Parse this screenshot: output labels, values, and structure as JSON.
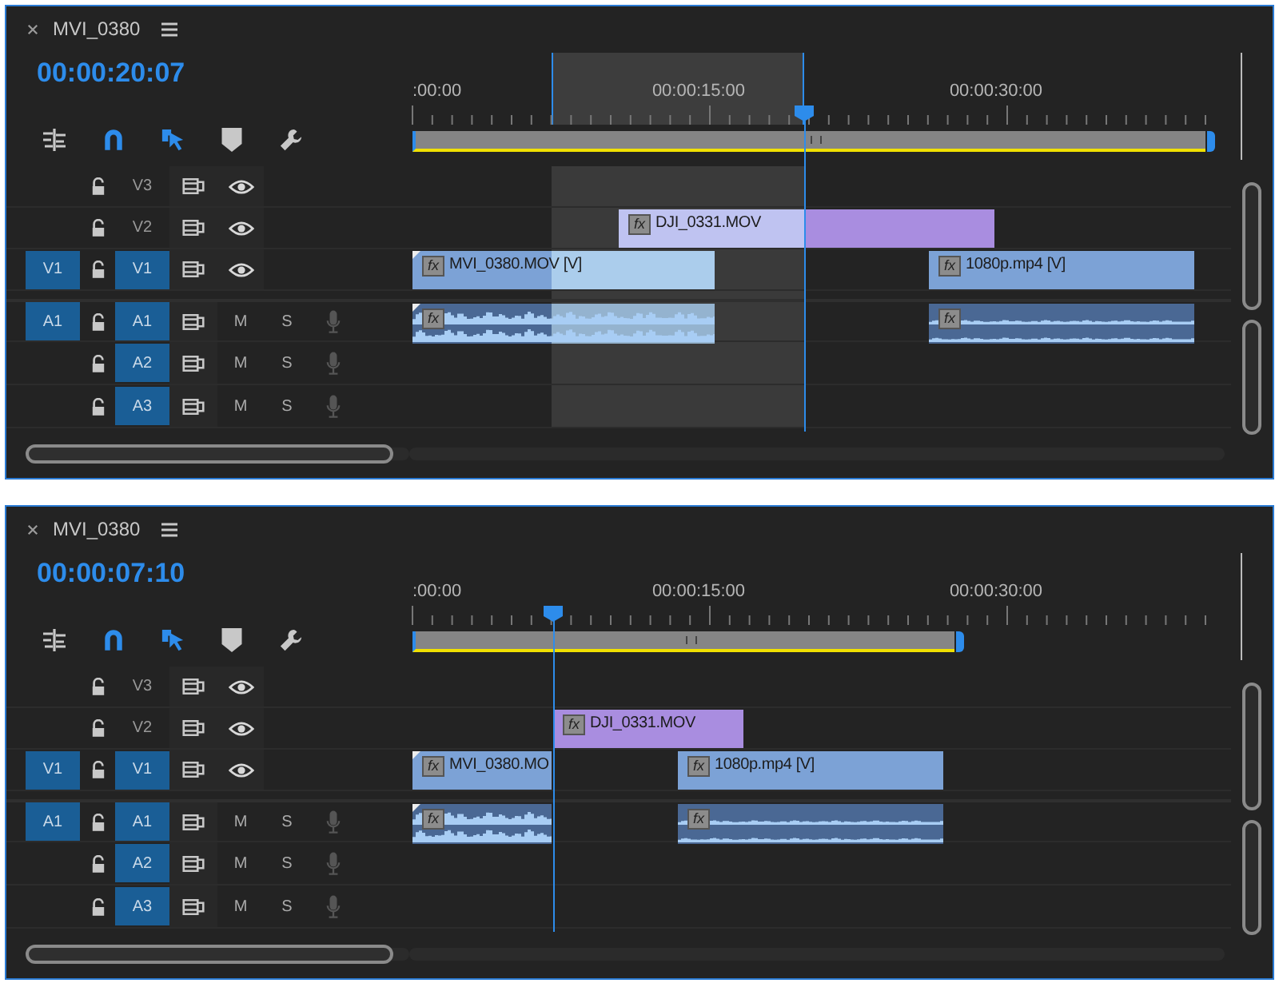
{
  "panels": [
    {
      "title": "MVI_0380",
      "timecode": "00:00:20:07",
      "ruler": [
        ":00:00",
        "00:00:15:00",
        "00:00:30:00"
      ],
      "in_out_marked": true,
      "tracks": [
        {
          "kind": "video",
          "label": "V3",
          "targeted": false
        },
        {
          "kind": "video",
          "label": "V2",
          "targeted": false,
          "clips": [
            {
              "kind": "video",
              "color": "#a98de0",
              "badge": "fx",
              "name": "DJI_0331.MOV"
            }
          ]
        },
        {
          "kind": "video",
          "source_patch": "V1",
          "label": "V1",
          "targeted": true,
          "clips": [
            {
              "kind": "video",
              "color": "#7ca2d6",
              "badge": "fx",
              "name": "MVI_0380.MOV [V]"
            },
            {
              "kind": "video",
              "color": "#7ca2d6",
              "badge": "fx",
              "name": "1080p.mp4 [V]"
            }
          ]
        },
        {
          "kind": "audio",
          "source_patch": "A1",
          "label": "A1",
          "targeted": true,
          "mute": "M",
          "solo": "S",
          "clips": [
            {
              "kind": "audio",
              "badge": "fx"
            },
            {
              "kind": "audio",
              "badge": "fx"
            }
          ]
        },
        {
          "kind": "audio",
          "label": "A2",
          "targeted": true,
          "mute": "M",
          "solo": "S"
        },
        {
          "kind": "audio",
          "label": "A3",
          "targeted": true,
          "mute": "M",
          "solo": "S"
        }
      ]
    },
    {
      "title": "MVI_0380",
      "timecode": "00:00:07:10",
      "ruler": [
        ":00:00",
        "00:00:15:00",
        "00:00:30:00"
      ],
      "in_out_marked": false,
      "tracks": [
        {
          "kind": "video",
          "label": "V3",
          "targeted": false
        },
        {
          "kind": "video",
          "label": "V2",
          "targeted": false,
          "clips": [
            {
              "kind": "video",
              "color": "#a98de0",
              "badge": "fx",
              "name": "DJI_0331.MOV"
            }
          ]
        },
        {
          "kind": "video",
          "source_patch": "V1",
          "label": "V1",
          "targeted": true,
          "clips": [
            {
              "kind": "video",
              "color": "#7ca2d6",
              "badge": "fx",
              "name": "MVI_0380.MO"
            },
            {
              "kind": "video",
              "color": "#7ca2d6",
              "badge": "fx",
              "name": "1080p.mp4 [V]"
            }
          ]
        },
        {
          "kind": "audio",
          "source_patch": "A1",
          "label": "A1",
          "targeted": true,
          "mute": "M",
          "solo": "S",
          "clips": [
            {
              "kind": "audio",
              "badge": "fx"
            },
            {
              "kind": "audio",
              "badge": "fx"
            }
          ]
        },
        {
          "kind": "audio",
          "label": "A2",
          "targeted": true,
          "mute": "M",
          "solo": "S"
        },
        {
          "kind": "audio",
          "label": "A3",
          "targeted": true,
          "mute": "M",
          "solo": "S"
        }
      ]
    }
  ]
}
